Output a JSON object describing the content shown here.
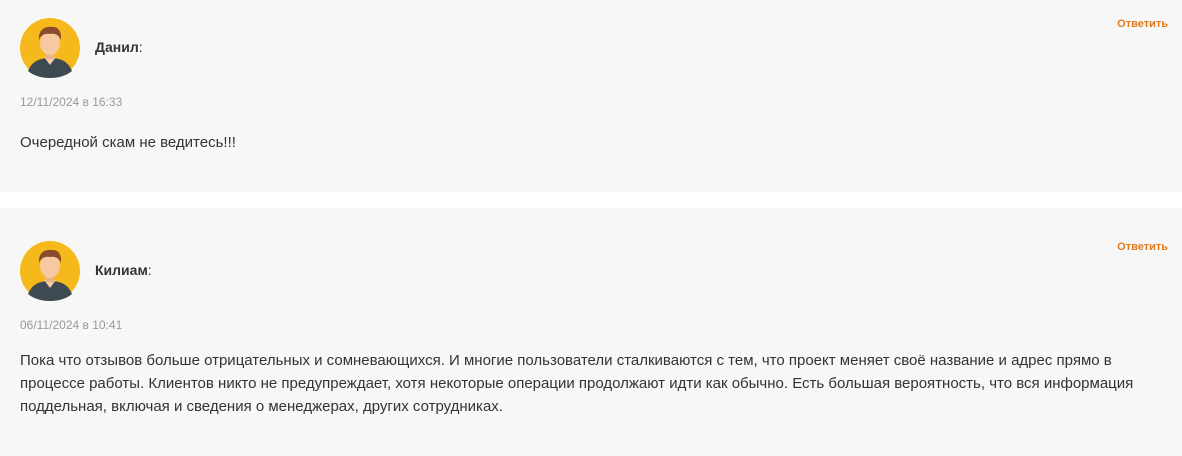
{
  "comments": [
    {
      "author": "Данил",
      "author_suffix": ":",
      "reply_label": "Ответить",
      "date": "12/11/2024 в 16:33",
      "text": "Очередной скам не ведитесь!!!"
    },
    {
      "author": "Килиам",
      "author_suffix": ":",
      "reply_label": "Ответить",
      "date": "06/11/2024 в 10:41",
      "text": "Пока что отзывов больше отрицательных и сомневающихся. И многие пользователи сталкиваются с тем, что проект меняет своё название и адрес прямо в процессе работы. Клиентов никто не предупреждает, хотя некоторые операции продолжают идти как обычно. Есть большая вероятность, что вся информация поддельная, включая и сведения о менеджерах, других сотрудниках."
    }
  ],
  "colors": {
    "card_bg": "#f7f7f7",
    "accent": "#e07b1f",
    "avatar_bg": "#f5b91b",
    "text": "#333333",
    "muted": "#999999"
  },
  "icons": {
    "avatar": "user-avatar-icon"
  }
}
